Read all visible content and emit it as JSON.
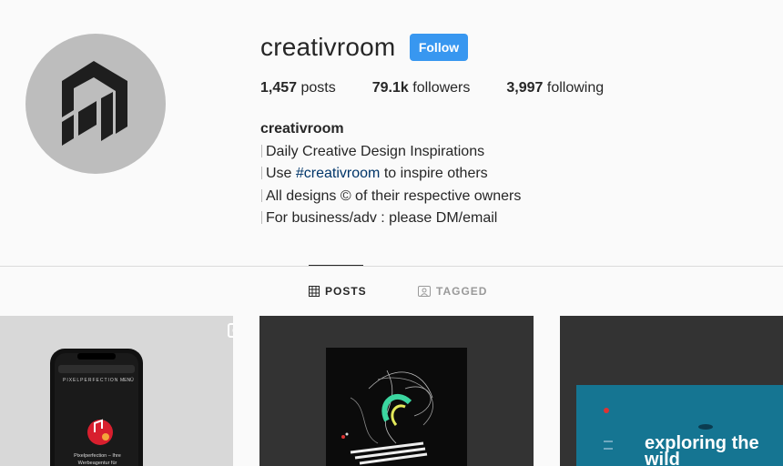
{
  "profile": {
    "username": "creativroom",
    "follow_label": "Follow",
    "stats": [
      {
        "count": "1,457",
        "label": "posts"
      },
      {
        "count": "79.1k",
        "label": "followers"
      },
      {
        "count": "3,997",
        "label": "following"
      }
    ],
    "bio": {
      "name": "creativroom",
      "line1": "Daily Creative Design Inspirations",
      "line2_pre": "Use ",
      "line2_tag": "#creativroom",
      "line2_post": " to inspire others",
      "line3": "All designs © of their respective owners",
      "line4": "For business/adv : please DM/email"
    }
  },
  "tabs": [
    {
      "label": "POSTS",
      "icon": "grid-icon",
      "active": true
    },
    {
      "label": "TAGGED",
      "icon": "tag-photo-icon",
      "active": false
    }
  ],
  "posts": [
    {
      "type": "video",
      "icon": "video-icon",
      "caption": "Pixelperfection – Ihre Werbeagentur für",
      "brand": "PIXELPERFECTION",
      "menu": "MENÜ"
    },
    {
      "type": "image",
      "caption": ""
    },
    {
      "type": "image",
      "caption": "exploring the wild"
    }
  ],
  "colors": {
    "background": "#fafafa",
    "follow_button": "#3897f0",
    "hashtag": "#003569",
    "avatar_bg": "#bdbdbd"
  }
}
